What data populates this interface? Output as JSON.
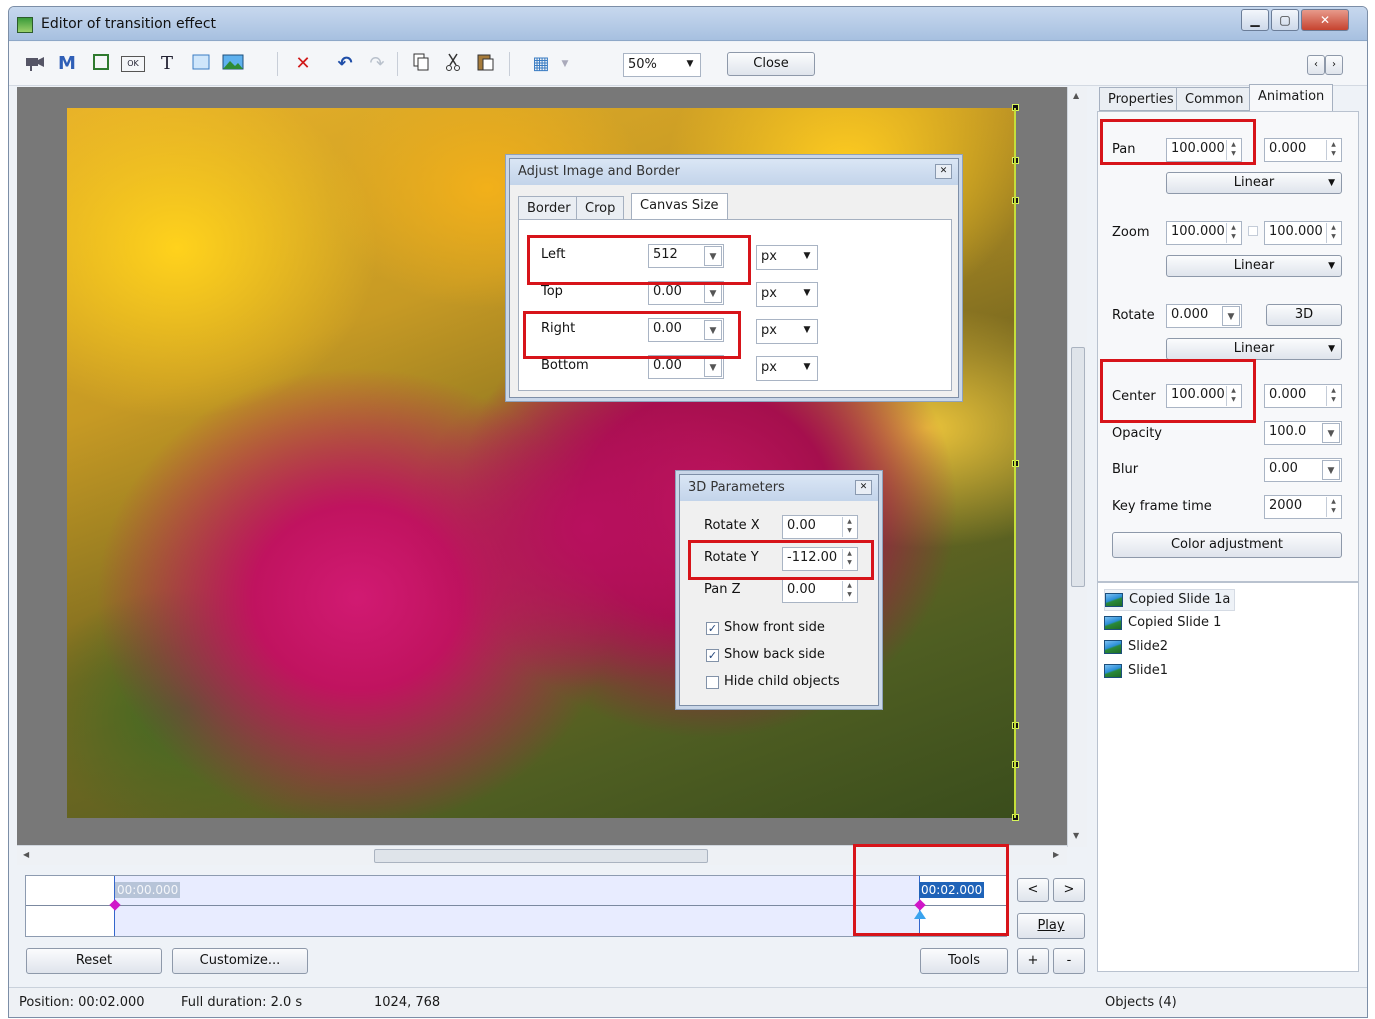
{
  "window": {
    "title": "Editor of transition effect",
    "minimize_symbol": "▁",
    "maximize_symbol": "▢",
    "close_symbol": "✕"
  },
  "toolbar": {
    "zoom_value": "50%",
    "close_label": "Close",
    "icons": [
      "camera-icon",
      "mask-icon",
      "frame-icon",
      "ok-button-icon",
      "text-icon",
      "rectangle-icon",
      "image-icon",
      "delete-icon",
      "undo-icon",
      "redo-icon",
      "copy-icon",
      "cut-icon",
      "paste-icon",
      "grid-icon"
    ],
    "mask_glyph": "M",
    "text_glyph": "T",
    "ok_glyph": "OK",
    "delete_glyph": "✕",
    "undo_glyph": "↶",
    "redo_glyph": "↷",
    "grid_glyph": "▦",
    "nav_left": "‹",
    "nav_right": "›"
  },
  "adjust_dialog": {
    "title": "Adjust Image and Border",
    "tabs": [
      "Border",
      "Crop",
      "Canvas Size"
    ],
    "active_tab": "Canvas Size",
    "rows": [
      {
        "label": "Left",
        "value": "512",
        "unit": "px"
      },
      {
        "label": "Top",
        "value": "0.00",
        "unit": "px"
      },
      {
        "label": "Right",
        "value": "0.00",
        "unit": "px"
      },
      {
        "label": "Bottom",
        "value": "0.00",
        "unit": "px"
      }
    ]
  },
  "params3d": {
    "title": "3D Parameters",
    "rotate_x_label": "Rotate X",
    "rotate_x": "0.00",
    "rotate_y_label": "Rotate Y",
    "rotate_y": "-112.00",
    "pan_z_label": "Pan Z",
    "pan_z": "0.00",
    "show_front_label": "Show front side",
    "show_front": true,
    "show_back_label": "Show back side",
    "show_back": true,
    "hide_child_label": "Hide child objects",
    "hide_child": false
  },
  "right_panel": {
    "tabs": [
      "Properties",
      "Common",
      "Animation"
    ],
    "active_tab": "Animation",
    "pan_label": "Pan",
    "pan_x": "100.000",
    "pan_y": "0.000",
    "pan_interp": "Linear",
    "zoom_label": "Zoom",
    "zoom_x": "100.000",
    "zoom_y": "100.000",
    "zoom_interp": "Linear",
    "rotate_label": "Rotate",
    "rotate_value": "0.000",
    "btn_3d": "3D",
    "rotate_interp": "Linear",
    "center_label": "Center",
    "center_x": "100.000",
    "center_y": "0.000",
    "opacity_label": "Opacity",
    "opacity_value": "100.0",
    "blur_label": "Blur",
    "blur_value": "0.00",
    "keyframe_label": "Key frame time",
    "keyframe_value": "2000",
    "color_adjust_label": "Color adjustment"
  },
  "objects": [
    "Copied Slide 1a",
    "Copied Slide 1",
    "Slide2",
    "Slide1"
  ],
  "timeline": {
    "start_time": "00:00.000",
    "end_time": "00:02.000",
    "prev_label": "<",
    "next_label": ">",
    "play_label": "Play",
    "reset_label": "Reset",
    "customize_label": "Customize...",
    "tools_label": "Tools",
    "plus_label": "+",
    "minus_label": "-"
  },
  "status": {
    "position": "Position:  00:02.000",
    "duration": "Full duration:  2.0 s",
    "resolution": "1024, 768",
    "objects_count": "Objects (4)"
  },
  "colors": {
    "highlight_red": "#d7141a",
    "timeline_accent": "#3366cc",
    "keyframe_magenta": "#d016c8"
  }
}
